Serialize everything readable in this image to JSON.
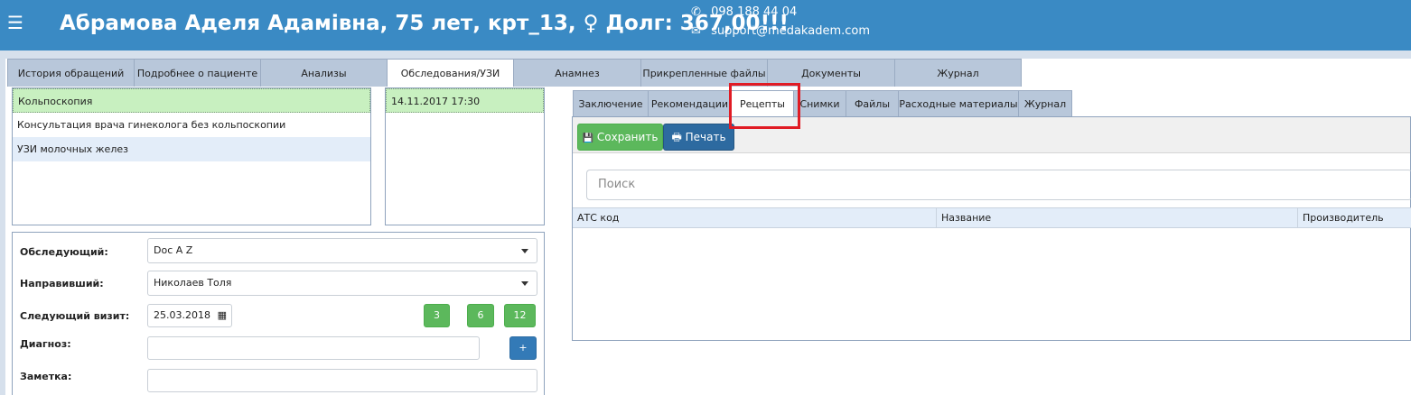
{
  "header": {
    "title": "Абрамова Аделя Адамівна, 75 лет, крт_13, ♀ Долг: 367,00!!!",
    "phone": "098 188 44 04",
    "email": "support@medakadem.com",
    "menu_icon": "☰",
    "phone_icon": "✆",
    "email_icon": "✉"
  },
  "top_tabs": [
    {
      "label": "История обращений"
    },
    {
      "label": "Подробнее о пациенте"
    },
    {
      "label": "Анализы"
    },
    {
      "label": "Обследования/УЗИ"
    },
    {
      "label": "Анамнез"
    },
    {
      "label": "Прикрепленные файлы"
    },
    {
      "label": "Документы"
    },
    {
      "label": "Журнал"
    }
  ],
  "exams": [
    {
      "label": "Кольпоскопия"
    },
    {
      "label": "Консультация врача гинеколога без кольпоскопии"
    },
    {
      "label": "УЗИ молочных желез"
    }
  ],
  "dates": [
    {
      "label": "14.11.2017 17:30"
    }
  ],
  "form": {
    "examiner_label": "Обследующий:",
    "examiner_value": "Doc A Z",
    "referrer_label": "Направивший:",
    "referrer_value": "Николаев Толя",
    "next_visit_label": "Следующий визит:",
    "next_visit_value": "25.03.2018",
    "calendar_icon": "▦",
    "interval_buttons": [
      "3",
      "6",
      "12"
    ],
    "diagnosis_label": "Диагноз:",
    "diagnosis_value": "",
    "add_label": "+",
    "note_label": "Заметка:",
    "note_value": ""
  },
  "sub_tabs": [
    {
      "label": "Заключение"
    },
    {
      "label": "Рекомендации"
    },
    {
      "label": "Рецепты"
    },
    {
      "label": "Снимки"
    },
    {
      "label": "Файлы"
    },
    {
      "label": "Расходные материалы"
    },
    {
      "label": "Журнал"
    }
  ],
  "toolbar": {
    "save_label": "Сохранить",
    "save_icon": "💾",
    "print_label": "Печать",
    "print_icon": "🖶"
  },
  "search": {
    "placeholder": "Поиск"
  },
  "grid": {
    "columns": [
      "АТС код",
      "Название",
      "Производитель"
    ]
  },
  "colors": {
    "header": "#3a8ac4",
    "tab": "#b8c7da",
    "selected_row": "#c8f0c0",
    "green_button": "#5cb85c",
    "blue_button": "#337ab7",
    "highlight": "#e01b24"
  }
}
